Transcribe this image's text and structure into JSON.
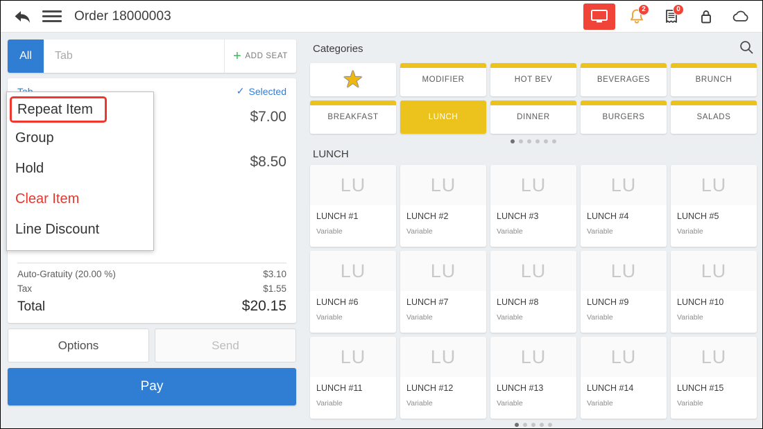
{
  "header": {
    "back_icon": "back-arrow-icon",
    "menu_icon": "hamburger-menu-icon",
    "title": "Order 18000003",
    "icons": [
      {
        "name": "monitor-icon",
        "glyph": "▭",
        "badge": null,
        "active": true
      },
      {
        "name": "bell-icon",
        "glyph": "🔔",
        "badge": "2",
        "active": false
      },
      {
        "name": "receipt-icon",
        "glyph": "▤",
        "badge": "0",
        "active": false
      },
      {
        "name": "lock-icon",
        "glyph": "🔒",
        "badge": null,
        "active": false
      },
      {
        "name": "cloud-icon",
        "glyph": "☁",
        "badge": null,
        "active": false
      }
    ]
  },
  "left_panel": {
    "seat_bar": {
      "all_label": "All",
      "tab_label": "Tab",
      "add_seat_label": "ADD SEAT",
      "add_seat_plus": "+"
    },
    "order": {
      "tab_label": "Tab",
      "selected_label": "Selected",
      "selected_check": "✓",
      "items": [
        {
          "price": "$7.00"
        },
        {
          "price": "$8.50"
        }
      ]
    },
    "totals": [
      {
        "label": "Auto-Gratuity (20.00 %)",
        "value": "$3.10",
        "emphasis": false
      },
      {
        "label": "Tax",
        "value": "$1.55",
        "emphasis": false
      },
      {
        "label": "Total",
        "value": "$20.15",
        "emphasis": true
      }
    ],
    "buttons": {
      "options_label": "Options",
      "send_label": "Send",
      "pay_label": "Pay"
    }
  },
  "context_menu": {
    "items": [
      {
        "label": "Repeat Item",
        "style": "highlighted"
      },
      {
        "label": "Group",
        "style": "normal"
      },
      {
        "label": "Hold",
        "style": "normal"
      },
      {
        "label": "Clear Item",
        "style": "danger"
      },
      {
        "label": "Line Discount",
        "style": "normal"
      }
    ]
  },
  "right_panel": {
    "categories_title": "Categories",
    "search_icon": "search-icon",
    "categories": [
      {
        "label": "",
        "icon": "star-icon",
        "selected": false,
        "has_bar": false
      },
      {
        "label": "MODIFIER",
        "selected": false,
        "has_bar": true
      },
      {
        "label": "HOT BEV",
        "selected": false,
        "has_bar": true
      },
      {
        "label": "BEVERAGES",
        "selected": false,
        "has_bar": true
      },
      {
        "label": "BRUNCH",
        "selected": false,
        "has_bar": true
      },
      {
        "label": "BREAKFAST",
        "selected": false,
        "has_bar": true
      },
      {
        "label": "LUNCH",
        "selected": true,
        "has_bar": true
      },
      {
        "label": "DINNER",
        "selected": false,
        "has_bar": true
      },
      {
        "label": "BURGERS",
        "selected": false,
        "has_bar": true
      },
      {
        "label": "SALADS",
        "selected": false,
        "has_bar": true
      }
    ],
    "category_pager": {
      "count": 6,
      "active": 0
    },
    "products_title": "LUNCH",
    "products": [
      {
        "thumb": "LU",
        "name": "LUNCH #1",
        "price": "Variable"
      },
      {
        "thumb": "LU",
        "name": "LUNCH #2",
        "price": "Variable"
      },
      {
        "thumb": "LU",
        "name": "LUNCH #3",
        "price": "Variable"
      },
      {
        "thumb": "LU",
        "name": "LUNCH #4",
        "price": "Variable"
      },
      {
        "thumb": "LU",
        "name": "LUNCH #5",
        "price": "Variable"
      },
      {
        "thumb": "LU",
        "name": "LUNCH #6",
        "price": "Variable"
      },
      {
        "thumb": "LU",
        "name": "LUNCH #7",
        "price": "Variable"
      },
      {
        "thumb": "LU",
        "name": "LUNCH #8",
        "price": "Variable"
      },
      {
        "thumb": "LU",
        "name": "LUNCH #9",
        "price": "Variable"
      },
      {
        "thumb": "LU",
        "name": "LUNCH #10",
        "price": "Variable"
      },
      {
        "thumb": "LU",
        "name": "LUNCH #11",
        "price": "Variable"
      },
      {
        "thumb": "LU",
        "name": "LUNCH #12",
        "price": "Variable"
      },
      {
        "thumb": "LU",
        "name": "LUNCH #13",
        "price": "Variable"
      },
      {
        "thumb": "LU",
        "name": "LUNCH #14",
        "price": "Variable"
      },
      {
        "thumb": "LU",
        "name": "LUNCH #15",
        "price": "Variable"
      }
    ],
    "product_pager": {
      "count": 5,
      "active": 0
    }
  },
  "colors": {
    "accent_blue": "#2f7ed4",
    "brand_yellow": "#ecc21c",
    "alert_red": "#f04438",
    "danger_text": "#e8362e",
    "green_plus": "#43b463",
    "page_bg": "#eceff1"
  }
}
